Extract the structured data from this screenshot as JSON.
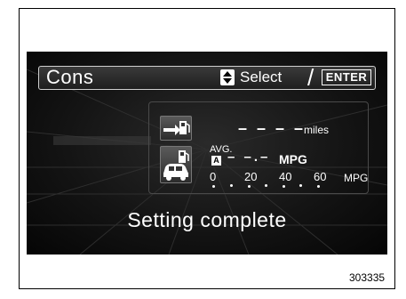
{
  "header": {
    "title": "Cons",
    "select_label": "Select",
    "slash": "/",
    "enter_label": "ENTER"
  },
  "distance": {
    "value": "– – – –",
    "unit": "miles"
  },
  "economy": {
    "avg_label": "AVG.",
    "mode_badge": "A",
    "value": "– –.–",
    "unit": "MPG"
  },
  "scale": {
    "ticks": [
      "0",
      "20",
      "40",
      "60"
    ],
    "unit": "MPG"
  },
  "status": "Setting complete",
  "figure_number": "303335",
  "colors": {
    "display_bg": "#141414",
    "text": "#ffffff"
  },
  "icons": [
    "up-down-arrows-icon",
    "fuel-pump-arrow-icon",
    "car-fuel-pump-icon"
  ]
}
